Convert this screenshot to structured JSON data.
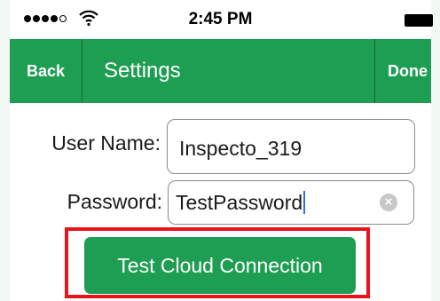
{
  "status_bar": {
    "time": "2:45 PM",
    "signal_icon": "signal-dots-icon",
    "wifi_icon": "wifi-icon",
    "battery_icon": "battery-icon"
  },
  "nav": {
    "back_label": "Back",
    "title": "Settings",
    "done_label": "Done"
  },
  "form": {
    "username_label": "User Name:",
    "username_value": "Inspecto_319",
    "password_label": "Password:",
    "password_value": "TestPassword",
    "clear_icon": "clear-circle-icon"
  },
  "actions": {
    "test_button_label": "Test Cloud Connection"
  },
  "colors": {
    "accent_green": "#1e9e52",
    "highlight_red": "#e8141b"
  }
}
